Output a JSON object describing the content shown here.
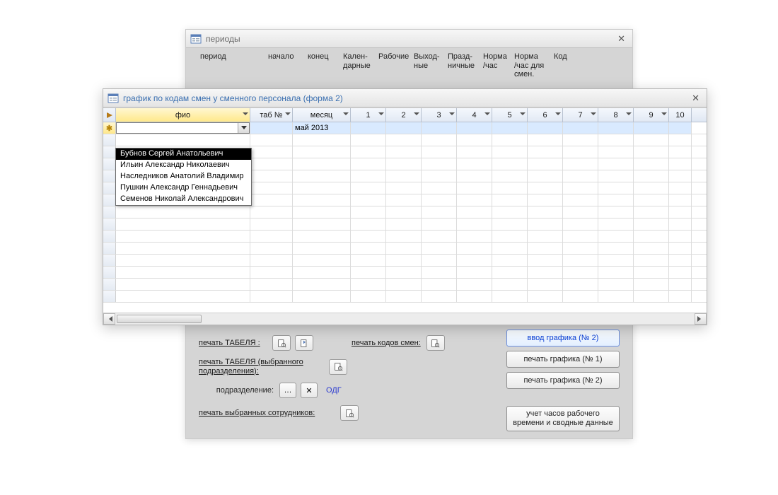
{
  "back_window": {
    "title": "периоды",
    "headers": {
      "period": "период",
      "start": "начало",
      "end": "конец",
      "calendar": "Кален-\nдарные",
      "work": "Рабочие",
      "weekend": "Выход-\nные",
      "holiday": "Празд-\nничные",
      "norm_hr": "Норма\n/час",
      "norm_hr_shift": "Норма\n/час для\nсмен.",
      "code": "Код"
    }
  },
  "bottom": {
    "print_tabel": "печать ТАБЕЛЯ :",
    "print_codes": "печать кодов смен:",
    "print_tabel_dept": "печать ТАБЕЛЯ (выбранного\nподразделения):",
    "dept_label": "подразделение:",
    "dept_value": "ОДГ",
    "print_selected": "печать выбранных сотрудников:",
    "btn_input2": "ввод графика (№ 2)",
    "btn_print1": "печать графика (№ 1)",
    "btn_print2": "печать графика (№ 2)",
    "btn_hours": "учет часов рабочего\nвремени и сводные данные",
    "x": "✕"
  },
  "front_window": {
    "title": "график по кодам смен у сменного персонала (форма 2)",
    "columns": {
      "fio": "фио",
      "tabno": "таб №",
      "month": "месяц",
      "days": [
        "1",
        "2",
        "3",
        "4",
        "5",
        "6",
        "7",
        "8",
        "9",
        "10"
      ]
    },
    "active_month": "май 2013",
    "new_marker": "✱",
    "dropdown": [
      "Бубнов Сергей Анатольевич",
      "Ильин Александр Николаевич",
      "Наследников Анатолий Владимир",
      "Пушкин Александр Геннадьевич",
      "Семенов Николай Александрович"
    ]
  }
}
